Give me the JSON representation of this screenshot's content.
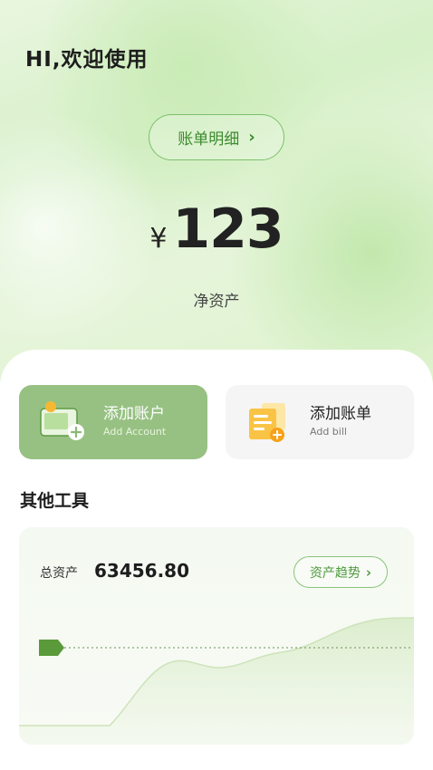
{
  "header": {
    "greeting": "HI,欢迎使用"
  },
  "bill_detail": {
    "label": "账单明细",
    "chevron": "›",
    "icon": "chevron-right-icon"
  },
  "balance": {
    "currency": "¥",
    "amount": "123",
    "label": "净资产"
  },
  "actions": [
    {
      "title": "添加账户",
      "subtitle": "Add Account",
      "icon": "wallet-add-icon"
    },
    {
      "title": "添加账单",
      "subtitle": "Add bill",
      "icon": "bill-add-icon"
    }
  ],
  "tools": {
    "title": "其他工具",
    "asset_label": "总资产",
    "asset_value": "63456.80",
    "trend_label": "资产趋势",
    "trend_chevron": "›"
  },
  "colors": {
    "accent": "#7cc06a",
    "accent_dark": "#4f9a3e",
    "card_green": "#97c183",
    "marker": "#5a9a3a",
    "bill_icon": "#f9c445"
  }
}
